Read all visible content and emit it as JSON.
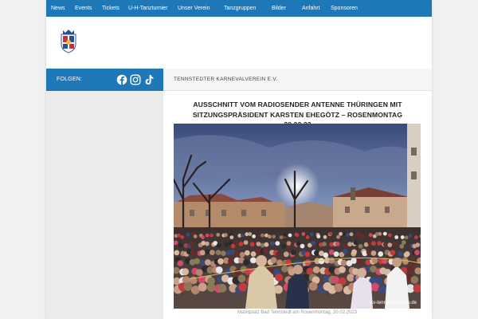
{
  "nav": {
    "items": [
      "News",
      "Events",
      "Tickets",
      "U-H-Tanzturnier",
      "Unser Verein",
      "Tanzgruppen",
      "Bilder",
      "Anfahrt",
      "Sponsoren"
    ]
  },
  "sidebar": {
    "follow_label": "FOLGEN:",
    "social_icons": [
      "facebook-icon",
      "instagram-icon",
      "tiktok-icon"
    ]
  },
  "main": {
    "breadcrumb": "TENNSTEDTER KARNEVALVEREIN E.V.",
    "title_line1": "AUSSCHNITT VOM RADIOSENDER ANTENNE THÜRINGEN MIT",
    "title_line2": "SITZUNGSPRÄSIDENT KARSTEN EHEGÖTZ – ROSENMONTAG 20.02.23",
    "photo_credit": "tkv-tennstedt-helau.de",
    "caption": "Marktplatz Bad Tennstedt am Rosenmontag, 20.02.2023"
  },
  "colors": {
    "accent": "#1e77b7",
    "sidebar_bg": "#ebebeb",
    "page_bg": "#f1f1f1"
  }
}
